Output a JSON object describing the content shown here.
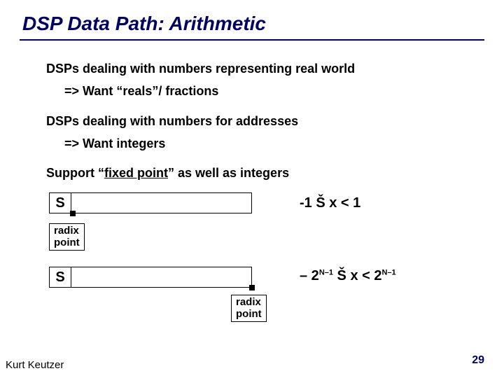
{
  "title": "DSP Data Path: Arithmetic",
  "body": {
    "line1": "DSPs dealing with numbers representing real world",
    "line1_sub": "=> Want “reals”/ fractions",
    "line2": "DSPs dealing with numbers for addresses",
    "line2_sub": "=> Want integers",
    "line3_pre": "Support “",
    "line3_u": "fixed point",
    "line3_post": "” as well as integers"
  },
  "regs": {
    "frac": {
      "sign": "S",
      "range": "-1 Š x < 1",
      "radix_label": "radix\npoint"
    },
    "int": {
      "sign": "S",
      "radix_label": "radix\npoint",
      "range_pre": "– 2",
      "range_exp1": "N–1",
      "range_mid": " Š  x <  2",
      "range_exp2": "N–1"
    }
  },
  "footer": {
    "author": "Kurt Keutzer",
    "page": "29"
  }
}
